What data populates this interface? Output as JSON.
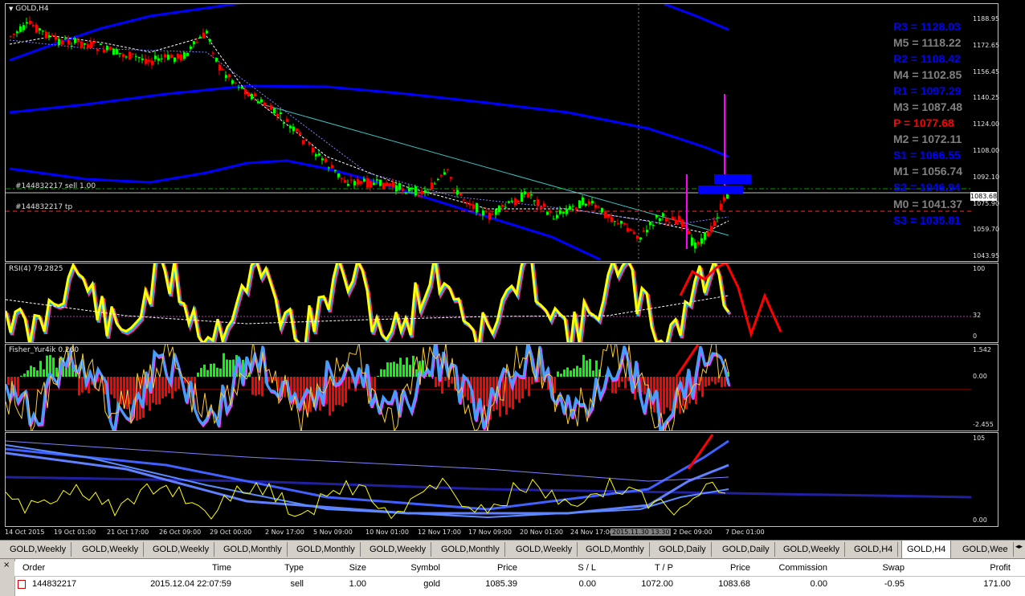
{
  "main_pane": {
    "title": "GOLD,H4",
    "order_line_label": "#144832217 sell 1.00",
    "tp_line_label": "#144832217 tp",
    "current_price": "1083.68",
    "price_ticks": [
      "1188.95",
      "1172.65",
      "1156.45",
      "1140.25",
      "1124.00",
      "1108.00",
      "1092.10",
      "1075.90",
      "1059.70",
      "1043.95"
    ]
  },
  "pivots": [
    {
      "label": "R3 = 1128.03",
      "color": "#0000ff"
    },
    {
      "label": "M5 = 1118.22",
      "color": "#808080"
    },
    {
      "label": "R2 = 1108.42",
      "color": "#0000ff"
    },
    {
      "label": "M4 = 1102.85",
      "color": "#808080"
    },
    {
      "label": "R1 = 1097.29",
      "color": "#0000ff"
    },
    {
      "label": "M3 = 1087.48",
      "color": "#808080"
    },
    {
      "label": "P   = 1077.68",
      "color": "#ff0000"
    },
    {
      "label": "M2 = 1072.11",
      "color": "#808080"
    },
    {
      "label": "S1 = 1066.55",
      "color": "#0000ff"
    },
    {
      "label": "M1 = 1056.74",
      "color": "#808080"
    },
    {
      "label": "S2 = 1046.94",
      "color": "#0000ff"
    },
    {
      "label": "M0 = 1041.37",
      "color": "#808080"
    },
    {
      "label": "S3 = 1035.81",
      "color": "#0000ff"
    }
  ],
  "rsi_pane": {
    "title": "RSI(4) 79.2825",
    "ticks": [
      "100",
      "32",
      "0"
    ]
  },
  "fisher_pane": {
    "title": "Fisher_Yur4ik 0.260",
    "ticks": [
      "1.542",
      "0.00",
      "-2.455"
    ]
  },
  "fourth_pane": {
    "title": "",
    "ticks": [
      "105",
      "0.00"
    ]
  },
  "time_axis": {
    "labels": [
      "14 Oct 2015",
      "19 Oct 01:00",
      "21 Oct 17:00",
      "26 Oct 09:00",
      "29 Oct 00:00",
      "2 Nov 17:00",
      "5 Nov 09:00",
      "10 Nov 01:00",
      "12 Nov 17:00",
      "17 Nov 09:00",
      "20 Nov 01:00",
      "24 Nov 17:00",
      "2015.11.30 13:30",
      "2 Dec 09:00",
      "7 Dec 01:00"
    ],
    "highlighted": "2015.11.30 13:30"
  },
  "tabs": [
    "GOLD,Weekly",
    "GOLD,Weekly",
    "GOLD,Weekly",
    "GOLD,Monthly",
    "GOLD,Monthly",
    "GOLD,Weekly",
    "GOLD,Monthly",
    "GOLD,Weekly",
    "GOLD,Monthly",
    "GOLD,Daily",
    "GOLD,Daily",
    "GOLD,Weekly",
    "GOLD,H4",
    "GOLD,H4",
    "GOLD,Wee"
  ],
  "active_tab_index": 13,
  "terminal": {
    "headers": [
      "Order",
      "Time",
      "Type",
      "Size",
      "Symbol",
      "Price",
      "S / L",
      "T / P",
      "Price",
      "Commission",
      "Swap",
      "Profit"
    ],
    "rows": [
      [
        "144832217",
        "2015.12.04 22:07:59",
        "sell",
        "1.00",
        "gold",
        "1085.39",
        "0.00",
        "1072.00",
        "1083.68",
        "0.00",
        "-0.95",
        "171.00"
      ]
    ]
  },
  "colors": {
    "bull": "#00ff00",
    "bear": "#ff0000",
    "band": "#0000ff",
    "rsi": "#ffff00",
    "arrow": "#ff0000",
    "magenta": "#ff00ff"
  }
}
